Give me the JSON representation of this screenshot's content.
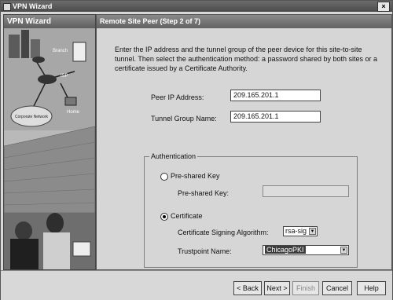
{
  "window": {
    "title": "VPN Wizard",
    "close_glyph": "×"
  },
  "sidebar": {
    "heading": "VPN Wizard",
    "illustration": {
      "labels": {
        "branch": "Branch",
        "isp": "ISP",
        "home": "Home",
        "corporate": "Corporate Network"
      }
    }
  },
  "main": {
    "heading": "Remote Site Peer  (Step 2 of 7)",
    "intro": "Enter the IP address and the tunnel group of the peer device for this site-to-site tunnel.  Then select the authentication method: a password shared by both sites or a certificate issued by a Certificate Authority.",
    "peer_ip": {
      "label": "Peer IP Address:",
      "value": "209.165.201.1"
    },
    "tunnel_group": {
      "label": "Tunnel Group Name:",
      "value": "209.165.201.1"
    },
    "auth": {
      "title": "Authentication",
      "psk_radio": {
        "label": "Pre-shared Key",
        "selected": false
      },
      "psk_field": {
        "label": "Pre-shared Key:",
        "value": ""
      },
      "cert_radio": {
        "label": "Certificate",
        "selected": true
      },
      "signing_algo": {
        "label": "Certificate Signing Algorithm:",
        "value": "rsa-sig"
      },
      "trustpoint": {
        "label": "Trustpoint Name:",
        "value": "ChicagoPKI"
      }
    }
  },
  "footer": {
    "back": "< Back",
    "next": "Next >",
    "finish": "Finish",
    "cancel": "Cancel",
    "help": "Help",
    "finish_disabled": true
  }
}
